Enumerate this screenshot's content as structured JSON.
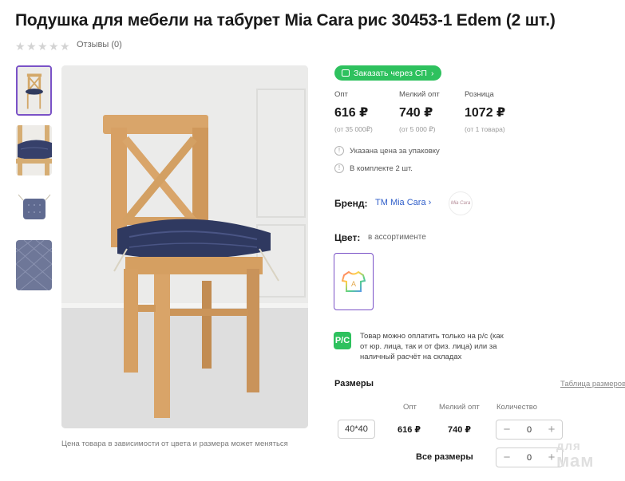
{
  "product": {
    "title": "Подушка для мебели на табурет Mia Cara рис 30453-1 Edem (2 шт.)",
    "rating_stars": 0,
    "reviews_label": "Отзывы (0)"
  },
  "gallery": {
    "thumbnails": [
      "thumb-chair",
      "thumb-cushion-on-chair",
      "thumb-cushion-flat",
      "thumb-fabric-pattern"
    ],
    "active_index": 0,
    "caption": "Цена товара в зависимости от цвета и размера может меняться"
  },
  "order_button": {
    "label": "Заказать через СП",
    "icon": "cart-icon",
    "arrow": "›"
  },
  "prices": [
    {
      "label": "Опт",
      "value": "616 ₽",
      "note": "(от 35 000₽)"
    },
    {
      "label": "Мелкий опт",
      "value": "740 ₽",
      "note": "(от 5 000 ₽)"
    },
    {
      "label": "Розница",
      "value": "1072 ₽",
      "note": "(от 1 товара)"
    }
  ],
  "info": [
    {
      "icon": "info-icon",
      "text": "Указана цена за упаковку"
    },
    {
      "icon": "info-icon",
      "text": "В комплекте 2 шт."
    }
  ],
  "brand": {
    "label": "Бренд:",
    "name": "ТМ Mia Cara",
    "arrow": "›",
    "logo_text": "Mia Cara"
  },
  "color": {
    "label": "Цвет:",
    "value": "в ассортименте",
    "swatch_letter": "A"
  },
  "payment": {
    "icon_text": "Р/С",
    "text": "Товар можно оплатить только на р/с (как от юр. лица, так и от физ. лица) или за наличный расчёт на складах"
  },
  "sizes": {
    "label": "Размеры",
    "table_link": "Таблица размеров",
    "columns": [
      "Опт",
      "Мелкий опт",
      "Количество"
    ],
    "rows": [
      {
        "size": "40*40",
        "opt": "616 ₽",
        "small_opt": "740 ₽",
        "qty": "0"
      }
    ],
    "all_sizes": {
      "label": "Все размеры",
      "qty": "0"
    },
    "minus": "−",
    "plus": "+"
  },
  "watermark": {
    "line1": "для",
    "line2": "мам"
  },
  "colors": {
    "accent_purple": "#7a52c7",
    "green": "#2ec15e",
    "link_blue": "#2f5ec9"
  }
}
